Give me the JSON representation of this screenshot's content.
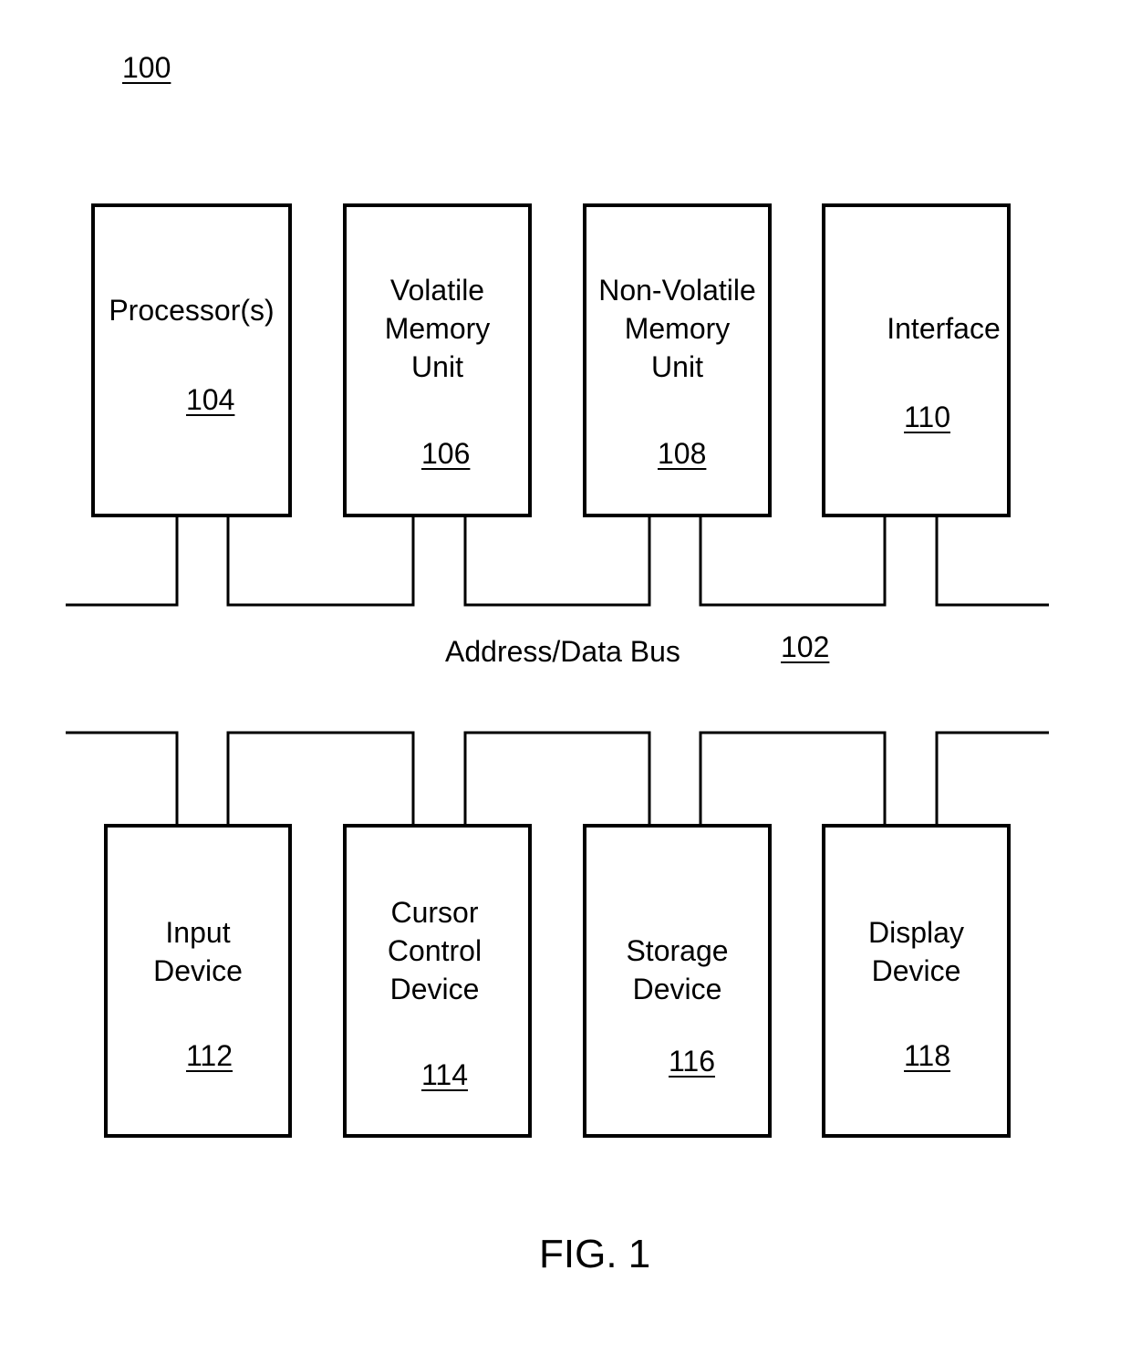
{
  "figure_ref": "100",
  "bus": {
    "label": "Address/Data Bus",
    "ref": "102"
  },
  "top_components": [
    {
      "label": "Processor(s)",
      "ref": "104"
    },
    {
      "label": "Volatile\nMemory\nUnit",
      "ref": "106"
    },
    {
      "label": "Non-Volatile\nMemory\nUnit",
      "ref": "108"
    },
    {
      "label": "Interface",
      "ref": "110"
    }
  ],
  "bottom_components": [
    {
      "label": "Input\nDevice",
      "ref": "112"
    },
    {
      "label": "Cursor\nControl\nDevice",
      "ref": "114"
    },
    {
      "label": "Storage\nDevice",
      "ref": "116"
    },
    {
      "label": "Display\nDevice",
      "ref": "118"
    }
  ],
  "caption": "FIG. 1"
}
